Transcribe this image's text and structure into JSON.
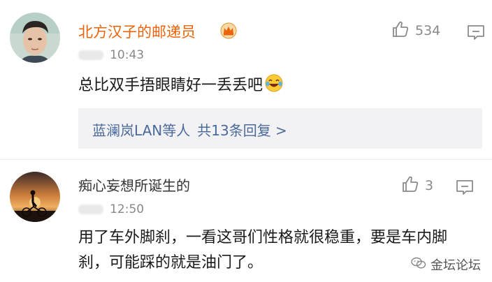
{
  "comments": [
    {
      "username": "北方汉子的邮递员",
      "time": "10:43",
      "likes": "534",
      "text": "总比双手捂眼睛好一丢丢吧",
      "replies": {
        "names": "蓝澜岚LAN等人",
        "summary": "共13条回复 >"
      },
      "username_color": "#e8630a"
    },
    {
      "username": "痴心妄想所诞生的",
      "time": "12:50",
      "likes": "3",
      "text": "用了车外脚刹，一看这哥们性格就很稳重，要是车内脚刹，可能踩的就是油门了。"
    }
  ],
  "watermark": "金坛论坛",
  "icons": {
    "badge": "crown-icon",
    "like": "thumbs-up-icon",
    "reply": "comment-icon",
    "emoji": "laughing-emoji-icon",
    "watermark": "wechat-icon"
  },
  "colors": {
    "reply_link": "#4a6a9c",
    "meta": "#888888",
    "replies_bg": "#f2f2f4"
  }
}
